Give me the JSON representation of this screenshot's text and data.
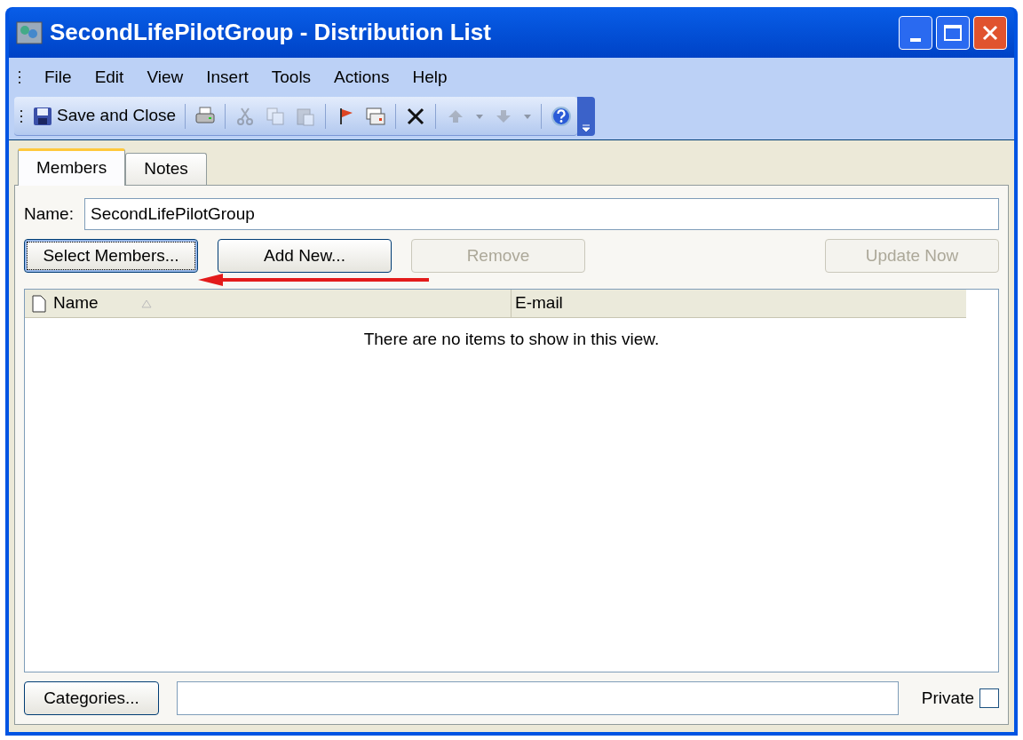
{
  "window": {
    "title": "SecondLifePilotGroup - Distribution List"
  },
  "menu": [
    "File",
    "Edit",
    "View",
    "Insert",
    "Tools",
    "Actions",
    "Help"
  ],
  "toolbar": [
    {
      "kind": "save",
      "label": "Save and Close",
      "disabled": false
    },
    {
      "kind": "separator"
    },
    {
      "kind": "print",
      "disabled": false
    },
    {
      "kind": "separator"
    },
    {
      "kind": "cut",
      "disabled": true
    },
    {
      "kind": "copy",
      "disabled": true
    },
    {
      "kind": "paste",
      "disabled": true
    },
    {
      "kind": "separator"
    },
    {
      "kind": "flag",
      "disabled": false
    },
    {
      "kind": "card",
      "disabled": false
    },
    {
      "kind": "separator"
    },
    {
      "kind": "delete",
      "disabled": false
    },
    {
      "kind": "separator"
    },
    {
      "kind": "up",
      "disabled": true
    },
    {
      "kind": "dropdown",
      "disabled": true
    },
    {
      "kind": "down",
      "disabled": true
    },
    {
      "kind": "dropdown",
      "disabled": true
    },
    {
      "kind": "separator"
    },
    {
      "kind": "help",
      "disabled": false
    }
  ],
  "tabs": [
    {
      "label": "Members",
      "selected": true
    },
    {
      "label": "Notes",
      "selected": false
    }
  ],
  "name_field": {
    "label": "Name:",
    "value": "SecondLifePilotGroup"
  },
  "buttons": [
    {
      "label": "Select Members...",
      "disabled": false,
      "focused": true
    },
    {
      "label": "Add New...",
      "disabled": false,
      "focused": false
    },
    {
      "label": "Remove",
      "disabled": true,
      "focused": false
    }
  ],
  "update_button": {
    "label": "Update Now",
    "disabled": true
  },
  "table": {
    "columns": [
      "Name",
      "E-mail"
    ],
    "empty_message": "There are no items to show in this view."
  },
  "categories_button": "Categories...",
  "private": {
    "label": "Private",
    "checked": false
  }
}
